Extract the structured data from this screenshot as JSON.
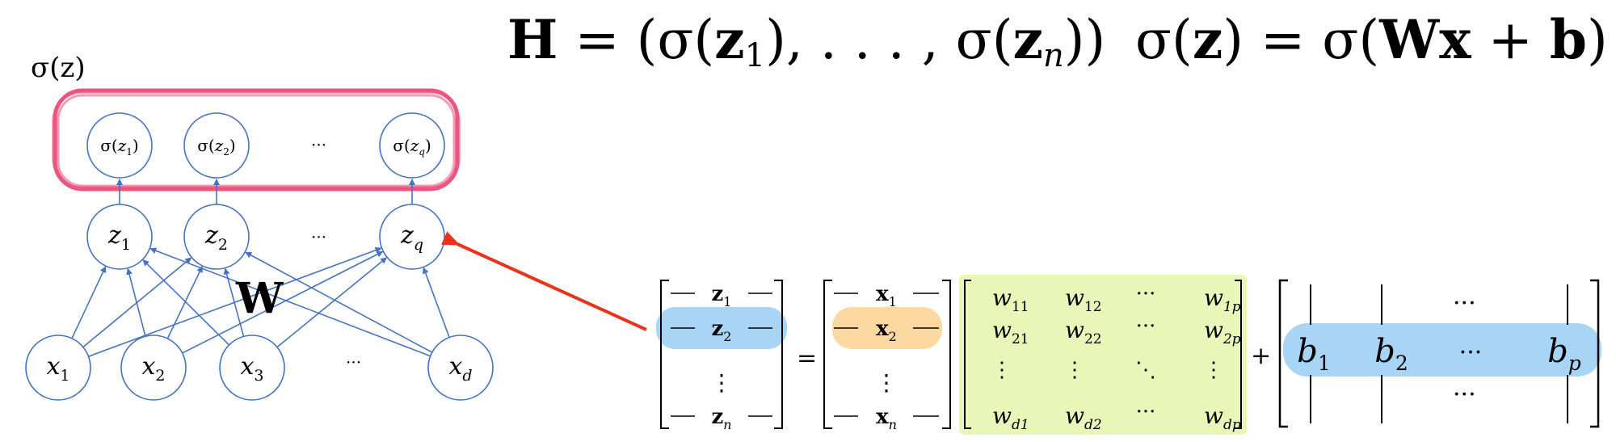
{
  "formula": {
    "H": "H",
    "eq1": " = (σ(",
    "z": "z",
    "sub1": "1",
    "mid": "), . . . , σ(",
    "subn": "n",
    "close": "))",
    "sigz_open": "σ(",
    "sigz_z": "z",
    "sigz_eq": ") = σ(",
    "W": "Wx",
    "plus": " + ",
    "b": "b",
    "end": ")"
  },
  "network": {
    "group_label": "σ(z)",
    "weight_label": "W",
    "sigma_nodes": [
      {
        "fn": "σ(",
        "var": "z",
        "sub": "1",
        "close": ")"
      },
      {
        "fn": "σ(",
        "var": "z",
        "sub": "2",
        "close": ")"
      },
      {
        "fn": "σ(",
        "var": "z",
        "sub": "q",
        "close": ")"
      }
    ],
    "hidden_nodes": [
      {
        "var": "z",
        "sub": "1"
      },
      {
        "var": "z",
        "sub": "2"
      },
      {
        "var": "z",
        "sub": "q"
      }
    ],
    "input_nodes": [
      {
        "var": "x",
        "sub": "1"
      },
      {
        "var": "x",
        "sub": "2"
      },
      {
        "var": "x",
        "sub": "3"
      },
      {
        "var": "x",
        "sub": "d"
      }
    ],
    "ellipsis": "···"
  },
  "matrix_eq": {
    "Z_rows": [
      {
        "var": "z",
        "sub": "1"
      },
      {
        "var": "z",
        "sub": "2"
      },
      {
        "var": "z",
        "sub": "n"
      }
    ],
    "X_rows": [
      {
        "var": "x",
        "sub": "1"
      },
      {
        "var": "x",
        "sub": "2"
      },
      {
        "var": "x",
        "sub": "n"
      }
    ],
    "vdots": "⋮",
    "equals": "=",
    "plus": "+",
    "W_cells": [
      [
        "w",
        "11",
        "w",
        "12",
        "···",
        "",
        "w",
        "1p"
      ],
      [
        "w",
        "21",
        "w",
        "22",
        "···",
        "",
        "w",
        "2p"
      ],
      [
        "⋮",
        "",
        "⋮",
        "",
        "⋱",
        "",
        "⋮",
        ""
      ],
      [
        "w",
        "d1",
        "w",
        "d2",
        "···",
        "",
        "w",
        "dp"
      ]
    ],
    "B_top": "···",
    "B_bottom": "···",
    "B_row": [
      {
        "var": "b",
        "sub": "1"
      },
      {
        "var": "b",
        "sub": "2"
      },
      {
        "var": "···",
        "sub": ""
      },
      {
        "var": "b",
        "sub": "p"
      }
    ]
  },
  "colors": {
    "node_stroke": "#4472c4",
    "highlight_pink": "#e8396a",
    "arrow_red": "#e8341c",
    "blue_highlight": "#a8d4f5",
    "orange_highlight": "#fbd9a0",
    "green_highlight": "#e8f7b8"
  }
}
